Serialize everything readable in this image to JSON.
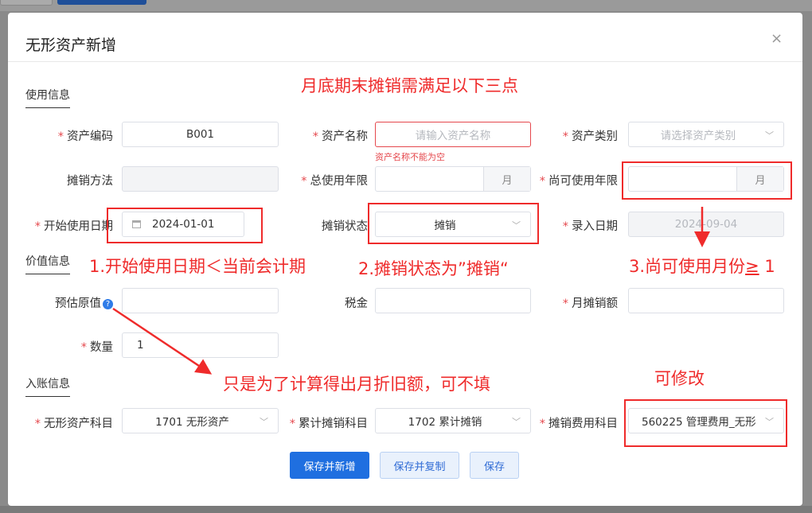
{
  "dialog": {
    "title": "无形资产新增",
    "close_glyph": "×"
  },
  "sections": {
    "usage": "使用信息",
    "value": "价值信息",
    "accounting": "入账信息"
  },
  "required_mark": "*",
  "fields": {
    "asset_code": {
      "label": "资产编码",
      "value": "B001"
    },
    "asset_name": {
      "label": "资产名称",
      "placeholder": "请输入资产名称",
      "error": "资产名称不能为空"
    },
    "asset_category": {
      "label": "资产类别",
      "placeholder": "请选择资产类别"
    },
    "amort_method": {
      "label": "摊销方法",
      "value": ""
    },
    "total_life": {
      "label": "总使用年限",
      "value": "",
      "unit": "月"
    },
    "remaining_life": {
      "label": "尚可使用年限",
      "value": "",
      "unit": "月"
    },
    "start_date": {
      "label": "开始使用日期",
      "value": "2024-01-01"
    },
    "amort_status": {
      "label": "摊销状态",
      "value": "摊销"
    },
    "entry_date": {
      "label": "录入日期",
      "value": "2024-09-04"
    },
    "est_original_value": {
      "label": "预估原值",
      "value": ""
    },
    "tax": {
      "label": "税金",
      "value": ""
    },
    "monthly_amort": {
      "label": "月摊销额",
      "value": ""
    },
    "quantity": {
      "label": "数量",
      "value": "1"
    },
    "intangible_account": {
      "label": "无形资产科目",
      "value": "1701 无形资产"
    },
    "accum_amort_account": {
      "label": "累计摊销科目",
      "value": "1702 累计摊销"
    },
    "amort_expense_account": {
      "label": "摊销费用科目",
      "value": "560225 管理费用_无形"
    }
  },
  "buttons": {
    "save_new": "保存并新增",
    "save_copy": "保存并复制",
    "save": "保存"
  },
  "annotations": {
    "heading": "月底期末摊销需满足以下三点",
    "point1": "1.开始使用日期＜当前会计期",
    "point2": "2.摊销状态为”摊销“",
    "point3_prefix": "3.尚可使用月份",
    "point3_symbol": "≥",
    "point3_suffix": " 1",
    "note_optional": "只是为了计算得出月折旧额，可不填",
    "note_editable": "可修改"
  },
  "icons": {
    "calendar": "calendar-icon",
    "chevron": "chevron-down-icon",
    "help": "help-icon",
    "close": "close-icon"
  },
  "colors": {
    "primary": "#1f6fe0",
    "required": "#e5484d",
    "annotation": "#ef2b2b"
  }
}
